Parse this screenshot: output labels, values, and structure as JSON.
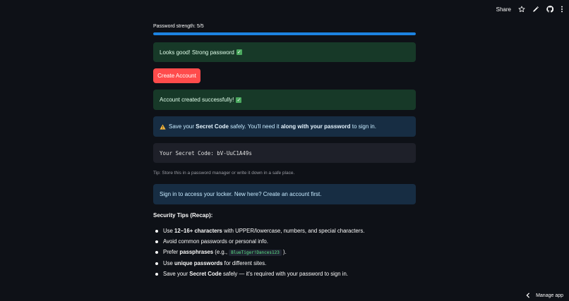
{
  "toolbar": {
    "share_label": "Share",
    "icons": [
      "star-icon",
      "pencil-icon",
      "github-icon",
      "kebab-menu-icon"
    ]
  },
  "strength": {
    "label": "Password strength: 5/5",
    "value": 5,
    "max": 5,
    "bar_color": "#1c83e1"
  },
  "alerts": {
    "strong": "Looks good! Strong password",
    "created": "Account created successfully!",
    "save_pre": "Save your ",
    "save_b1": "Secret Code",
    "save_mid": " safely. You'll need it ",
    "save_b2": "along with your password",
    "save_post": " to sign in.",
    "signin": "Sign in to access your locker. New here? Create an account first."
  },
  "create_button": {
    "label": "Create Account",
    "color": "#ff4b4b"
  },
  "secret": {
    "label": "Your Secret Code: ",
    "code": "bV-UuC1A49s"
  },
  "tip": "Tip: Store this in a password manager or write it down in a safe place.",
  "tips_title": "Security Tips (Recap):",
  "tips": [
    {
      "pre": "Use ",
      "bold": "12–16+ characters",
      "post": " with UPPER/lowercase, numbers, and special characters."
    },
    {
      "pre": "Avoid common passwords or personal info.",
      "bold": "",
      "post": ""
    },
    {
      "pre": "Prefer ",
      "bold": "passphrases",
      "post": " (e.g., ",
      "code": "BlueTiger!Dances123",
      "post2": " )."
    },
    {
      "pre": "Use ",
      "bold": "unique passwords",
      "post": " for different sites."
    },
    {
      "pre": "Save your ",
      "bold": "Secret Code",
      "post": " safely — it's required with your password to sign in."
    }
  ],
  "manage_app": "Manage app",
  "colors": {
    "background": "#0e1117",
    "success_bg": "#173928",
    "info_bg": "#172d43",
    "code_bg": "#1e2029",
    "inline_code": "#5ce488"
  }
}
